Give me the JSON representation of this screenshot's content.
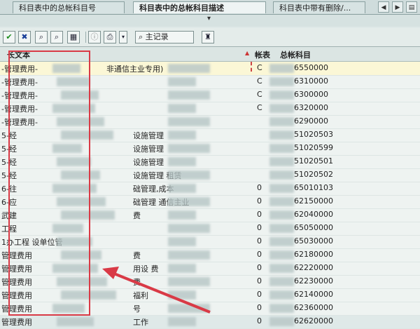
{
  "tabs": [
    {
      "label": "科目表中的总帐科目号"
    },
    {
      "label": "科目表中的总帐科目描述"
    },
    {
      "label": "科目表中带有删除/..."
    }
  ],
  "toolbar": {
    "master_label": "主记录"
  },
  "grid": {
    "header": {
      "col_name": "长文本",
      "col_c": "帐表",
      "col_code": "总帐科目"
    },
    "rows": [
      {
        "name": "-管理费用-",
        "note": "非通信主业专用)",
        "c": "C",
        "code": "6550000"
      },
      {
        "name": "-管理费用-",
        "note": "",
        "c": "C",
        "code": "6310000"
      },
      {
        "name": "-管理费用-",
        "note": "",
        "c": "C",
        "code": "6300000"
      },
      {
        "name": "-管理费用-",
        "note": "",
        "c": "C",
        "code": "6320000"
      },
      {
        "name": "-管理费用-",
        "note": "",
        "c": "",
        "code": "6290000"
      },
      {
        "name": "5-经",
        "note": "设施管理",
        "c": "",
        "code": "51020503"
      },
      {
        "name": "5-经",
        "note": "设施管理",
        "c": "",
        "code": "51020599"
      },
      {
        "name": "5-经",
        "note": "设施管理",
        "c": "",
        "code": "51020501"
      },
      {
        "name": "5-经",
        "note": "设施管理  租赁",
        "c": "",
        "code": "51020502"
      },
      {
        "name": "6-往",
        "note": "础管理,成本",
        "c": "0",
        "code": "65010103"
      },
      {
        "name": "6-应",
        "note": "础管理  通信主业",
        "c": "0",
        "code": "62150000"
      },
      {
        "name": "武建",
        "note": "费",
        "c": "0",
        "code": "62040000"
      },
      {
        "name": "工程",
        "note": "",
        "c": "0",
        "code": "65050000"
      },
      {
        "name": "1办工程 设单位管",
        "note": "",
        "c": "0",
        "code": "65030000"
      },
      {
        "name": "管理费用",
        "note": "费",
        "c": "0",
        "code": "62180000"
      },
      {
        "name": "管理费用",
        "note": "用设  费",
        "c": "0",
        "code": "62220000"
      },
      {
        "name": "管理费用",
        "note": "费",
        "c": "0",
        "code": "62230000"
      },
      {
        "name": "管理费用",
        "note": "福利",
        "c": "0",
        "code": "62140000"
      },
      {
        "name": "管理费用",
        "note": "号",
        "c": "0",
        "code": "62360000"
      },
      {
        "name": "管理费用",
        "note": "工作",
        "c": "0",
        "code": "62620000"
      }
    ]
  }
}
